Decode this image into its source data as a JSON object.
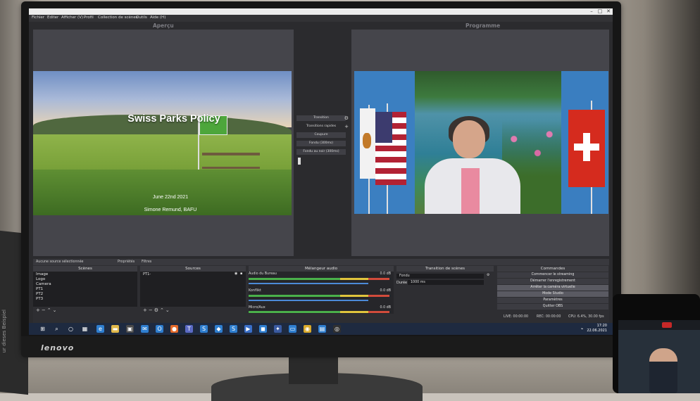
{
  "window": {
    "menu": [
      "Fichier",
      "Editer",
      "Afficher (V)",
      "Profil",
      "Collection de scènes",
      "Outils",
      "Aide (H)"
    ]
  },
  "preview": {
    "title": "Aperçu",
    "slide_title": "Swiss Parks Policy",
    "slide_date": "June 22nd 2021",
    "slide_author": "Simone Remund, BAFU"
  },
  "program": {
    "title": "Programme"
  },
  "transitions": {
    "label": "Transition",
    "quick": "Transitions rapides",
    "cut": "Coupure",
    "fade": "Fondu (300ms)",
    "fade_black": "Fondu au noir (300ms)"
  },
  "info": {
    "no_source": "Aucune source sélectionnée",
    "properties": "Propriétés",
    "filters": "Filtres"
  },
  "scenes": {
    "title": "Scènes",
    "items": [
      "Image",
      "Logo",
      "Camera",
      "PT1",
      "PT2",
      "PT3"
    ]
  },
  "sources": {
    "title": "Sources",
    "items": [
      "PT1-"
    ]
  },
  "mixer": {
    "title": "Mélangeur audio",
    "channels": [
      {
        "name": "Audio du Bureau",
        "db": "0.0 dB"
      },
      {
        "name": "Konflikt",
        "db": "0.0 dB"
      },
      {
        "name": "Micro/Aux",
        "db": "0.0 dB"
      }
    ]
  },
  "scene_transitions": {
    "title": "Transition de scènes",
    "selected": "Fondu",
    "duration_label": "Durée",
    "duration_value": "1000 ms"
  },
  "controls": {
    "title": "Commandes",
    "buttons": [
      "Commencer le streaming",
      "Démarrer l'enregistrement",
      "Arrêter la caméra virtuelle",
      "Mode Studio",
      "Paramètres",
      "Quitter OBS"
    ]
  },
  "status": {
    "live": "LIVE: 00:00:00",
    "rec": "REC: 00:00:00",
    "cpu": "CPU: 6.4%, 30.00 fps"
  },
  "taskbar": {
    "time": "17:20",
    "date": "22.06.2021"
  },
  "hardware": {
    "brand": "lenovo",
    "side_text": "ur dieses Beispiel"
  },
  "colors": {
    "obs_background": "#2b2b2e",
    "panel": "#45454b",
    "accent_blue": "#4c8ad8",
    "taskbar": "#1e2a40"
  }
}
